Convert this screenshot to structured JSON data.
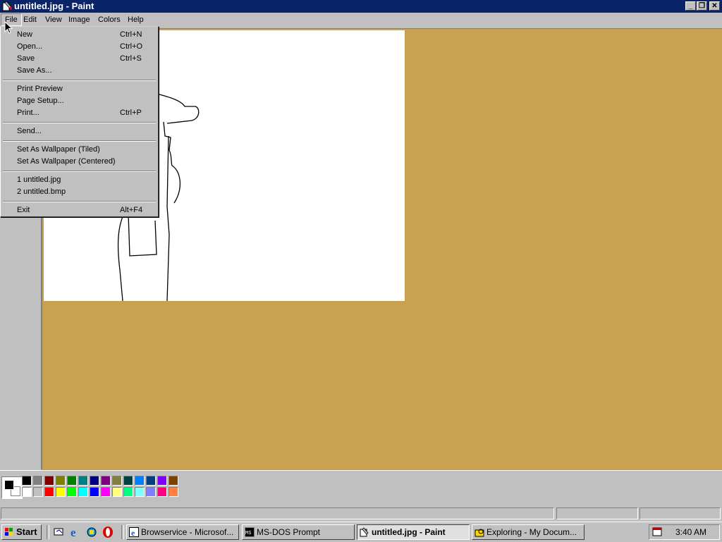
{
  "window": {
    "title": "untitled.jpg - Paint"
  },
  "menubar": {
    "items": [
      "File",
      "Edit",
      "View",
      "Image",
      "Colors",
      "Help"
    ]
  },
  "file_menu": {
    "groups": [
      [
        {
          "label": "New",
          "shortcut": "Ctrl+N"
        },
        {
          "label": "Open...",
          "shortcut": "Ctrl+O"
        },
        {
          "label": "Save",
          "shortcut": "Ctrl+S"
        },
        {
          "label": "Save As...",
          "shortcut": ""
        }
      ],
      [
        {
          "label": "Print Preview",
          "shortcut": ""
        },
        {
          "label": "Page Setup...",
          "shortcut": ""
        },
        {
          "label": "Print...",
          "shortcut": "Ctrl+P"
        }
      ],
      [
        {
          "label": "Send...",
          "shortcut": ""
        }
      ],
      [
        {
          "label": "Set As Wallpaper (Tiled)",
          "shortcut": ""
        },
        {
          "label": "Set As Wallpaper (Centered)",
          "shortcut": ""
        }
      ],
      [
        {
          "label": "1 untitled.jpg",
          "shortcut": ""
        },
        {
          "label": "2 untitled.bmp",
          "shortcut": ""
        }
      ],
      [
        {
          "label": "Exit",
          "shortcut": "Alt+F4"
        }
      ]
    ]
  },
  "palette": {
    "top_row": [
      "#000000",
      "#808080",
      "#800000",
      "#808000",
      "#008000",
      "#008080",
      "#000080",
      "#800080",
      "#808040",
      "#004040",
      "#0080ff",
      "#004080",
      "#8000ff",
      "#804000"
    ],
    "bottom_row": [
      "#ffffff",
      "#c0c0c0",
      "#ff0000",
      "#ffff00",
      "#00ff00",
      "#00ffff",
      "#0000ff",
      "#ff00ff",
      "#ffff80",
      "#00ff80",
      "#80ffff",
      "#8080ff",
      "#ff0080",
      "#ff8040"
    ],
    "foreground": "#000000",
    "background": "#ffffff"
  },
  "colors": {
    "workspace": "#c8a250",
    "titlebar": "#0a246a"
  },
  "taskbar": {
    "start": "Start",
    "tasks": [
      {
        "label": "Browservice - Microsof...",
        "icon": "ie-window-icon",
        "pressed": false
      },
      {
        "label": "MS-DOS Prompt",
        "icon": "msdos-icon",
        "pressed": false
      },
      {
        "label": "untitled.jpg - Paint",
        "icon": "paint-icon",
        "pressed": true
      },
      {
        "label": "Exploring - My Docum...",
        "icon": "explorer-icon",
        "pressed": false
      }
    ],
    "quicklaunch": [
      "desktop-icon",
      "ie-icon",
      "channels-icon",
      "opera-icon"
    ],
    "clock": "3:40 AM"
  }
}
